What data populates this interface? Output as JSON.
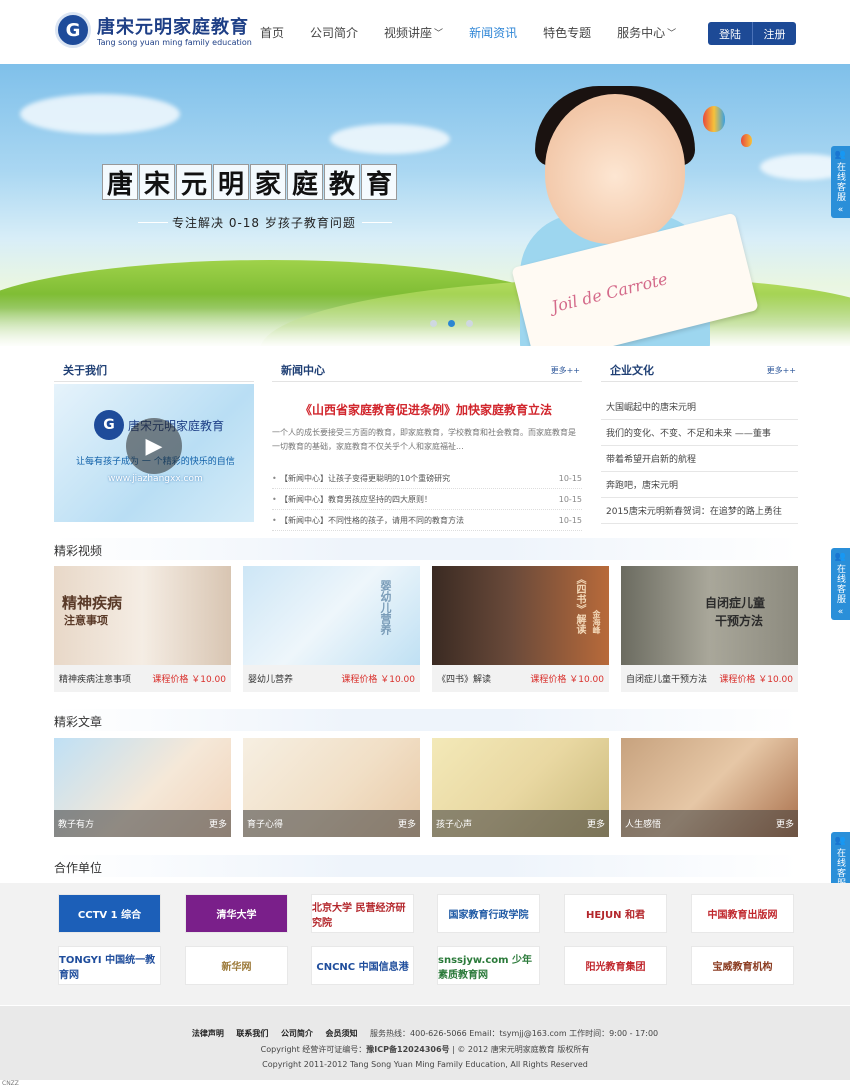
{
  "header": {
    "logo_mark": "G",
    "logo_cn": "唐宋元明家庭教育",
    "logo_en": "Tang song yuan ming family education",
    "nav": [
      {
        "label": "首页",
        "dropdown": false,
        "active": false
      },
      {
        "label": "公司简介",
        "dropdown": false,
        "active": false
      },
      {
        "label": "视频讲座",
        "dropdown": true,
        "active": false
      },
      {
        "label": "新闻资讯",
        "dropdown": false,
        "active": true
      },
      {
        "label": "特色专题",
        "dropdown": false,
        "active": false
      },
      {
        "label": "服务中心",
        "dropdown": true,
        "active": false
      }
    ],
    "login_label": "登陆",
    "register_label": "注册"
  },
  "banner": {
    "title_chars": [
      "唐",
      "宋",
      "元",
      "明",
      "家",
      "庭",
      "教",
      "育"
    ],
    "subtitle": "专注解决 0-18 岁孩子教育问题",
    "book_text": "Joil de Carrote",
    "slides": 3,
    "active_slide": 2
  },
  "side_tab": {
    "icon": "person-icon",
    "label": "在线客服",
    "arrow": "«"
  },
  "about": {
    "title": "关于我们",
    "video_logo": "唐宋元明家庭教育",
    "video_tag": "让每有孩子成为 一 个精彩的快乐的自信",
    "video_url": "www.jiazhangxx.com"
  },
  "news": {
    "title": "新闻中心",
    "more": "更多++",
    "headline": "《山西省家庭教育促进条例》加快家庭教育立法",
    "intro": "一个人的成长要接受三方面的教育，即家庭教育，学校教育和社会教育。而家庭教育是一切教育的基础，家庭教育不仅关乎个人和家庭福祉...",
    "items": [
      {
        "text": "【新闻中心】让孩子变得更聪明的10个重磅研究",
        "date": "10-15"
      },
      {
        "text": "【新闻中心】教育男孩应坚持的四大原则！",
        "date": "10-15"
      },
      {
        "text": "【新闻中心】不同性格的孩子，请用不同的教育方法",
        "date": "10-15"
      }
    ]
  },
  "culture": {
    "title": "企业文化",
    "more": "更多++",
    "items": [
      "大国崛起中的唐宋元明",
      "我们的变化、不变、不足和未来 ——董事",
      "带着希望开启新的航程",
      "奔跑吧，唐宋元明",
      "2015唐宋元明新春贺词：在追梦的路上勇往"
    ]
  },
  "videos": {
    "title": "精彩视频",
    "items": [
      {
        "name": "精神疾病注意事项",
        "price": "课程价格 ￥10.00",
        "overlay": "精神疾病",
        "overlay2": "注意事项"
      },
      {
        "name": "婴幼儿营养",
        "price": "课程价格 ￥10.00",
        "overlay": "婴幼儿营养",
        "overlay2": ""
      },
      {
        "name": "《四书》解读",
        "price": "课程价格 ￥10.00",
        "overlay": "《四书》解读",
        "overlay2": "金海峰"
      },
      {
        "name": "自闭症儿童干预方法",
        "price": "课程价格 ￥10.00",
        "overlay": "自闭症儿童",
        "overlay2": "干预方法"
      }
    ]
  },
  "articles": {
    "title": "精彩文章",
    "more": "更多",
    "items": [
      {
        "name": "教子有方"
      },
      {
        "name": "育子心得"
      },
      {
        "name": "孩子心声"
      },
      {
        "name": "人生感悟"
      }
    ]
  },
  "partners": {
    "title": "合作单位",
    "logos": [
      {
        "text": "CCTV 1 综合",
        "color": "#1c5fb8"
      },
      {
        "text": "清华大学",
        "color": "#7a1f8a"
      },
      {
        "text": "北京大学 民营经济研究院",
        "color": "#b3262b"
      },
      {
        "text": "国家教育行政学院",
        "color": "#1f5aa5"
      },
      {
        "text": "HEJUN 和君",
        "color": "#b3262b"
      },
      {
        "text": "中国教育出版网",
        "color": "#c0272d"
      },
      {
        "text": "TONGYI 中国统一教育网",
        "color": "#1f4d9c"
      },
      {
        "text": "新华网",
        "color": "#9c7a3a"
      },
      {
        "text": "CNCNC 中国信息港",
        "color": "#1f4d9c"
      },
      {
        "text": "snssjyw.com 少年素质教育网",
        "color": "#2b7a3a"
      },
      {
        "text": "阳光教育集团",
        "color": "#c0272d"
      },
      {
        "text": "宝威教育机构",
        "color": "#8a3a1f"
      }
    ]
  },
  "footer": {
    "links": [
      "法律声明",
      "联系我们",
      "公司简介",
      "会员须知"
    ],
    "contact": "服务热线：400-626-5066 Email：tsymjj@163.com 工作时间：9:00 - 17:00",
    "license_prefix": "Copyright 经营许可证编号：",
    "icp": "豫ICP备12024306号",
    "license_suffix": " | © 2012 唐宋元明家庭教育 版权所有",
    "copyright": "Copyright 2011-2012 Tang Song Yuan Ming Family Education, All Rights Reserved"
  },
  "cnzz": "CNZZ"
}
